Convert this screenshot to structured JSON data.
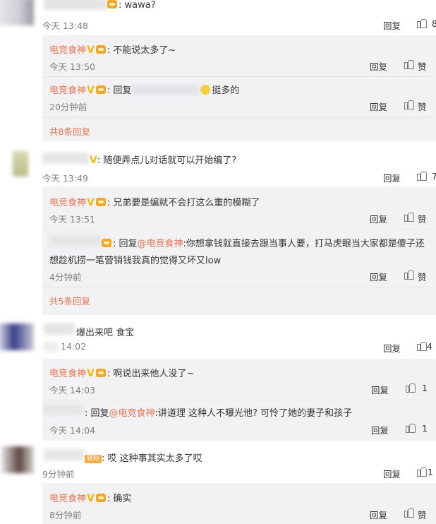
{
  "c1": {
    "text": ":  wawa?",
    "time": "今天 13:48",
    "reply": "回复",
    "likes": "8"
  },
  "c1r1": {
    "author": "电竞食神",
    "text": ":  不能说太多了~",
    "time": "今天 13:50",
    "reply": "回复",
    "like": "赞"
  },
  "c1r2": {
    "author": "电竞食神",
    "prefix": ":  回复",
    "suffix": "挺多的",
    "time": "20分钟前",
    "reply": "回复",
    "like": "赞"
  },
  "c1_more": "共8条回复",
  "c2": {
    "text": ":  随便弄点儿对话就可以开始编了?",
    "time": "今天 13:49",
    "reply": "回复",
    "likes": "7"
  },
  "c2r1": {
    "author": "电竞食神",
    "text": ":  兄弟要是编就不会打这么重的模糊了",
    "time": "今天 13:51",
    "reply": "回复",
    "like": "赞"
  },
  "c2r2": {
    "prefix": ":  回复",
    "at": "@电竞食神",
    "line1": ":你想拿钱就直接去跟当事人要，打马虎眼当大家都是傻子还",
    "line2": "想趁机捞一笔营销钱我真的觉得又坏又low",
    "time": "4分钟前",
    "reply": "回复",
    "like": "赞"
  },
  "c2_more": "共5条回复",
  "c3": {
    "text": "爆出来吧  食宝",
    "time": "14:02",
    "reply": "回复",
    "likes": "4"
  },
  "c3r1": {
    "author": "电竞食神",
    "text": ":  啊说出来他人没了~",
    "time": "今天 14:03",
    "reply": "回复",
    "likes": "1"
  },
  "c3r2": {
    "prefix": ":  回复",
    "at": "@电竞食神",
    "text": ":讲道理  这种人不曝光他?  可怜了她的妻子和孩子",
    "time": "今天 14:04",
    "reply": "回复",
    "likes": "1"
  },
  "c4": {
    "badge": "铁粉",
    "text": ":  哎  这种事其实太多了哎",
    "time": "9分钟前",
    "reply": "回复",
    "likes": "1"
  },
  "c4r1": {
    "author": "电竞食神",
    "text": ":  确实",
    "time": "8分钟前",
    "reply": "回复",
    "like": "赞"
  },
  "icons": [
    "thumbs-up-icon",
    "verified-v-icon",
    "crown-badge-icon",
    "fan-badge-icon",
    "laughing-emoji-icon"
  ],
  "colors": {
    "author": "#eb7350",
    "reply_bg": "#f2f2f5",
    "text": "#333333",
    "meta": "#808080"
  }
}
